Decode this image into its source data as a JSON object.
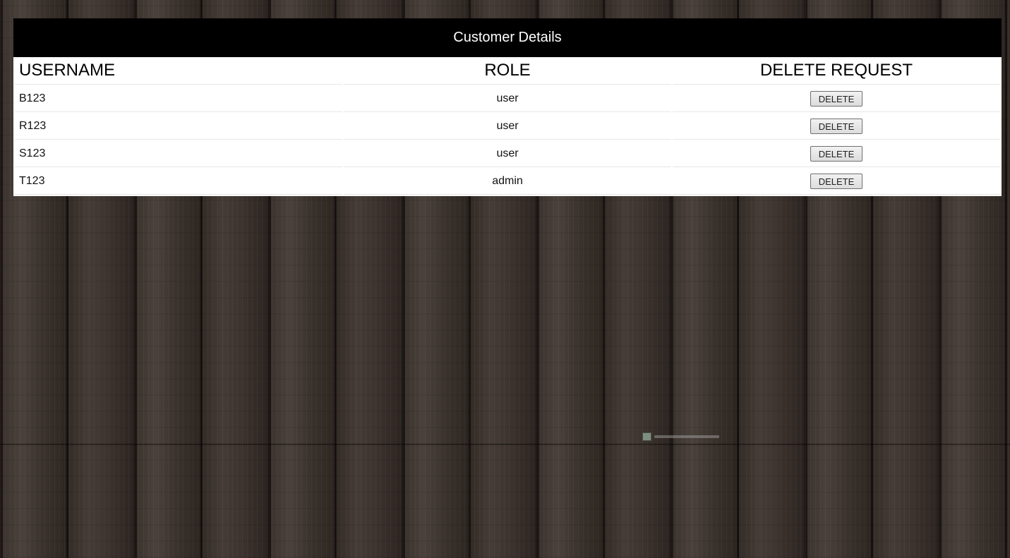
{
  "header": {
    "title": "Customer Details"
  },
  "table": {
    "columns": [
      "USERNAME",
      "ROLE",
      "DELETE REQUEST"
    ],
    "rows": [
      {
        "username": "B123",
        "role": "user",
        "action": "DELETE"
      },
      {
        "username": "R123",
        "role": "user",
        "action": "DELETE"
      },
      {
        "username": "S123",
        "role": "user",
        "action": "DELETE"
      },
      {
        "username": "T123",
        "role": "admin",
        "action": "DELETE"
      }
    ]
  },
  "colors": {
    "header_bg": "#000000",
    "header_text": "#ffffff",
    "panel_bg": "#ffffff",
    "background": "dark-wood-planks"
  },
  "watermark": {
    "icon": "watermark-logo-icon"
  }
}
